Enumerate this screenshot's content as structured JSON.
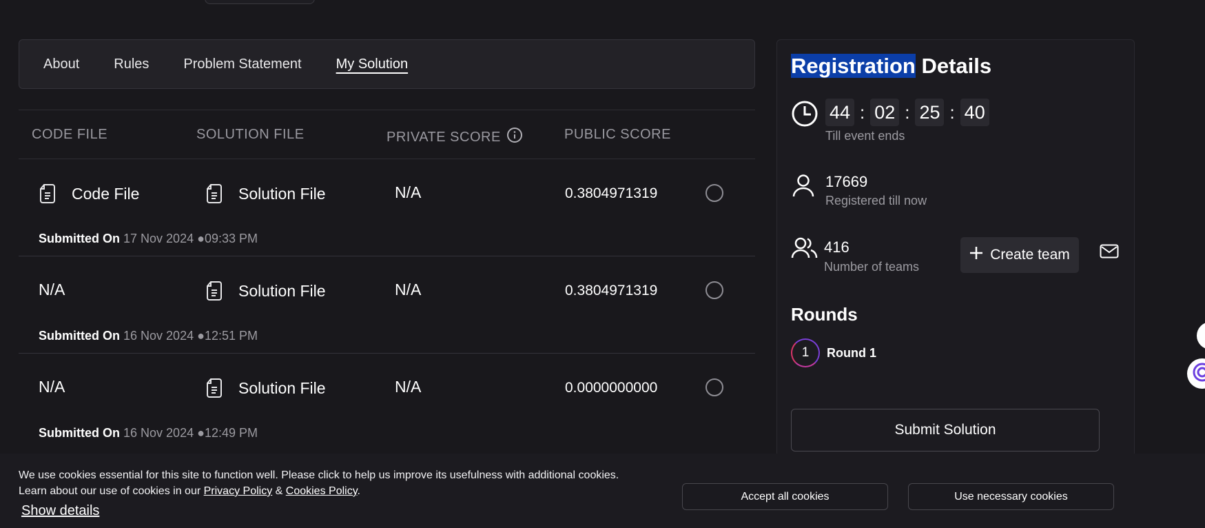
{
  "tabs": [
    {
      "label": "About"
    },
    {
      "label": "Rules"
    },
    {
      "label": "Problem Statement"
    },
    {
      "label": "My Solution",
      "active": true
    }
  ],
  "table": {
    "headers": {
      "code_file": "CODE FILE",
      "solution_file": "SOLUTION FILE",
      "private_score": "PRIVATE SCORE",
      "public_score": "PUBLIC SCORE"
    },
    "submitted_on_label": "Submitted On",
    "rows": [
      {
        "code_file": "Code File",
        "solution_file": "Solution File",
        "private_score": "N/A",
        "public_score": "0.3804971319",
        "date": "17 Nov 2024",
        "time": "09:33 PM"
      },
      {
        "code_file": "N/A",
        "solution_file": "Solution File",
        "private_score": "N/A",
        "public_score": "0.3804971319",
        "date": "16 Nov 2024",
        "time": "12:51 PM"
      },
      {
        "code_file": "N/A",
        "solution_file": "Solution File",
        "private_score": "N/A",
        "public_score": "0.0000000000",
        "date": "16 Nov 2024",
        "time": "12:49 PM"
      }
    ]
  },
  "sidebar": {
    "title_highlight": "Registration",
    "title_rest": " Details",
    "timer": {
      "days": "44",
      "hours": "02",
      "minutes": "25",
      "seconds": "40",
      "sep": ":"
    },
    "timer_label": "Till event ends",
    "registered_count": "17669",
    "registered_label": "Registered till now",
    "teams_count": "416",
    "teams_label": "Number of teams",
    "create_team_label": "Create team",
    "rounds_title": "Rounds",
    "round_number": "1",
    "round_name": "Round 1",
    "submit_label": "Submit Solution"
  },
  "cookie": {
    "line1": "We use cookies essential for this site to function well. Please click to help us improve its usefulness with additional cookies.",
    "line2_prefix": "Learn about our use of cookies in our ",
    "privacy_link": "Privacy Policy",
    "amp": " & ",
    "cookies_link": "Cookies Policy",
    "period": ".",
    "show_details": "Show details",
    "accept_all": "Accept all cookies",
    "use_necessary": "Use necessary cookies"
  },
  "colors": {
    "background": "#19181c",
    "highlight": "#0b3ea8",
    "panel": "#232227"
  }
}
